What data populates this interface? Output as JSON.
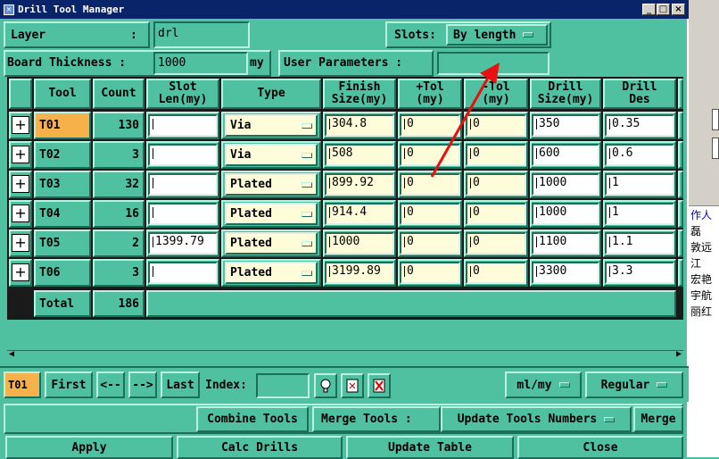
{
  "window": {
    "title": "Drill Tool Manager",
    "min": "_",
    "max": "□",
    "close": "×"
  },
  "top": {
    "layer_label": "Layer",
    "layer_colon": ":",
    "layer_value": "drl",
    "slots_label": "Slots:",
    "slots_value": "By length",
    "board_thickness_label": "Board Thickness :",
    "board_thickness_value": "1000",
    "board_thickness_unit": "my",
    "user_params_label": "User Parameters :",
    "user_params_value": ""
  },
  "table": {
    "headers": [
      "Tool",
      "Count",
      "Slot\nLen(my)",
      "Type",
      "Finish\nSize(my)",
      "+Tol\n(my)",
      "-Tol\n(my)",
      "Drill\nSize(my)",
      "Drill\nDes"
    ],
    "rows": [
      {
        "tool": "T01",
        "count": "130",
        "slot": "",
        "type": "Via",
        "finish": "304.8",
        "ptol": "0",
        "ntol": "0",
        "drill": "350",
        "des": "0.35"
      },
      {
        "tool": "T02",
        "count": "3",
        "slot": "",
        "type": "Via",
        "finish": "508",
        "ptol": "0",
        "ntol": "0",
        "drill": "600",
        "des": "0.6"
      },
      {
        "tool": "T03",
        "count": "32",
        "slot": "",
        "type": "Plated",
        "finish": "899.92",
        "ptol": "0",
        "ntol": "0",
        "drill": "1000",
        "des": "1"
      },
      {
        "tool": "T04",
        "count": "16",
        "slot": "",
        "type": "Plated",
        "finish": "914.4",
        "ptol": "0",
        "ntol": "0",
        "drill": "1000",
        "des": "1"
      },
      {
        "tool": "T05",
        "count": "2",
        "slot": "1399.79",
        "type": "Plated",
        "finish": "1000",
        "ptol": "0",
        "ntol": "0",
        "drill": "1100",
        "des": "1.1"
      },
      {
        "tool": "T06",
        "count": "3",
        "slot": "",
        "type": "Plated",
        "finish": "3199.89",
        "ptol": "0",
        "ntol": "0",
        "drill": "3300",
        "des": "3.3"
      }
    ],
    "total_label": "Total",
    "total_count": "186"
  },
  "nav": {
    "current": "T01",
    "first": "First",
    "prev": "<--",
    "next": "-->",
    "last": "Last",
    "index_label": "Index:",
    "index_value": "",
    "units": "ml/my",
    "mode": "Regular"
  },
  "actions": {
    "combine": "Combine Tools",
    "merge_label": "Merge Tools :",
    "update_numbers": "Update Tools Numbers",
    "merge": "Merge",
    "apply": "Apply",
    "calc": "Calc Drills",
    "update_table": "Update Table",
    "close": "Close"
  },
  "side": {
    "items": [
      "作人",
      "磊",
      "敦远",
      "江",
      "宏艳",
      "宇航",
      "丽红"
    ]
  },
  "colors": {
    "panel": "#4fc1a0",
    "selected_tool": "#f7b14a",
    "input_yellow": "#fffcd9",
    "annotation_arrow": "#e81010"
  },
  "icons": {
    "plus": "plus-box-icon",
    "dropdown": "dropdown-indicator-icon",
    "bulb": "lightbulb-icon",
    "script": "script-icon",
    "delete": "delete-icon"
  }
}
